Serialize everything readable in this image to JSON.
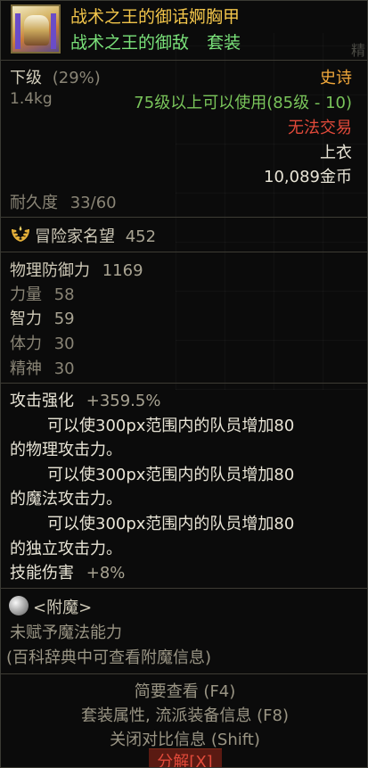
{
  "item": {
    "name": "战术之王的御话婀胸甲",
    "set_name": "战术之王的御敌",
    "set_tag": "套装",
    "faint_text": "精",
    "grade": "下级",
    "grade_percent": "(29%)",
    "rarity": "史诗",
    "weight": "1.4kg",
    "level_requirement": "75级以上可以使用(85级 - 10)",
    "trade_status": "无法交易",
    "slot": "上衣",
    "price": "10,089金币",
    "durability_label": "耐久度",
    "durability_value": "33/60",
    "reputation_label": "冒险家名望",
    "reputation_value": "452"
  },
  "stats": [
    {
      "label": "物理防御力",
      "value": "1169"
    },
    {
      "label": "力量",
      "value": "58"
    },
    {
      "label": "智力",
      "value": "59"
    },
    {
      "label": "体力",
      "value": "30"
    },
    {
      "label": "精神",
      "value": "30"
    }
  ],
  "effects": {
    "attack_boost_label": "攻击强化",
    "attack_boost_value": "+359.5%",
    "line1a": "可以使300px范围内的队员增加80",
    "line1b": "的物理攻击力。",
    "line2a": "可以使300px范围内的队员增加80",
    "line2b": "的魔法攻击力。",
    "line3a": "可以使300px范围内的队员增加80",
    "line3b": "的独立攻击力。",
    "skill_damage_label": "技能伤害",
    "skill_damage_value": "+8%"
  },
  "enchant": {
    "title": "<附魔>",
    "none": "未赋予魔法能力",
    "hint": "(百科辞典中可查看附魔信息)"
  },
  "footer": {
    "brief_view": "简要查看 (F4)",
    "set_info": "套装属性, 流派装备信息 (F8)",
    "close_compare": "关闭对比信息 (Shift)",
    "decompose": "分解[X]"
  },
  "colors": {
    "item_name": "#f2c54a",
    "set_green": "#7ae27a",
    "rarity_orange": "#f2a83a",
    "trade_red": "#e24a3a",
    "stat_text": "#cfcab8"
  }
}
